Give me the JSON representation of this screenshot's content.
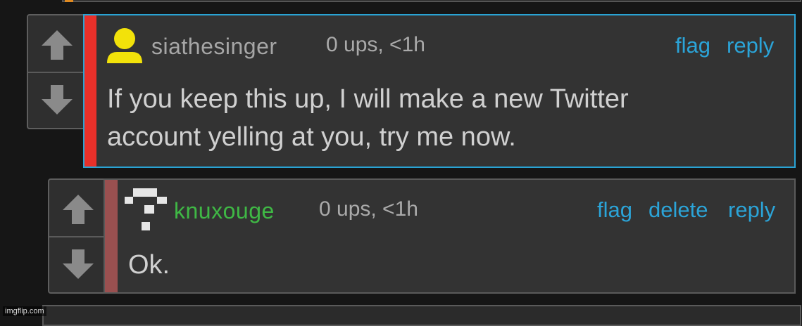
{
  "comments": [
    {
      "username": "siathesinger",
      "username_color": "#a6a6a6",
      "bar_color": "#e8302a",
      "meta": "0 ups, <1h",
      "actions": [
        "flag",
        "reply"
      ],
      "body": [
        "If you keep this up, I will make a new Twitter",
        "account yelling at you, try me now."
      ],
      "avatar_icon": "yellow-person-icon",
      "avatar_color": "#f2e20a"
    },
    {
      "username": "knuxouge",
      "username_color": "#3fb845",
      "bar_color": "#9a5050",
      "meta": "0 ups, <1h",
      "actions": [
        "flag",
        "delete",
        "reply"
      ],
      "body": [
        "Ok."
      ],
      "avatar_icon": "pixel-question-mark-icon",
      "avatar_color": "#e6e6e6"
    }
  ],
  "vote_icons": {
    "up": "up-arrow-icon",
    "down": "down-arrow-icon"
  },
  "watermark": "imgflip.com"
}
